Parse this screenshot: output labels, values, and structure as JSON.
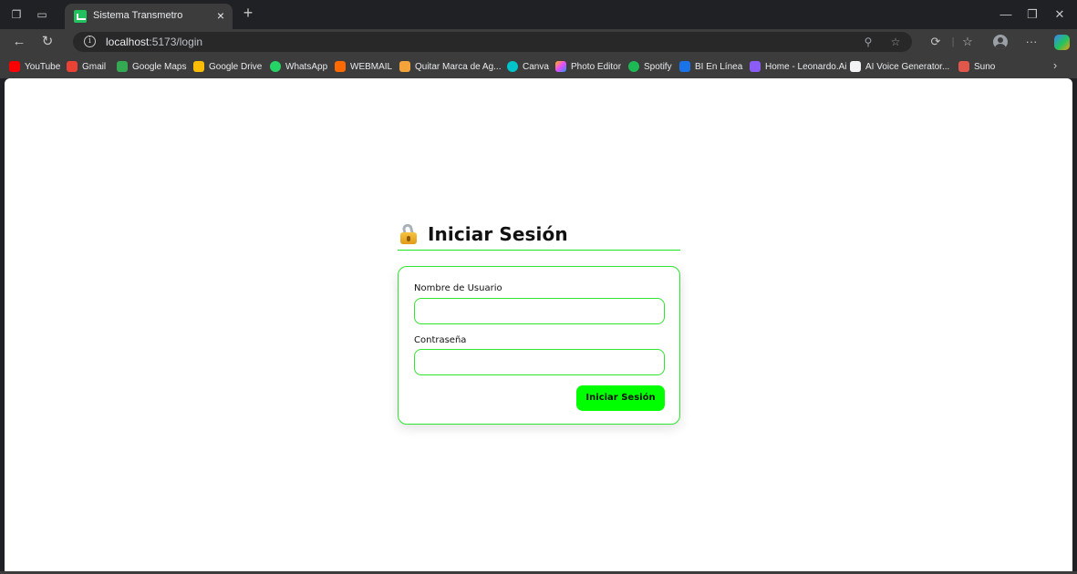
{
  "browser": {
    "tab": {
      "title": "Sistema Transmetro",
      "close_glyph": "×"
    },
    "new_tab_glyph": "+",
    "url": {
      "host": "localhost",
      "rest": ":5173/login"
    },
    "bookmarks": [
      {
        "name": "youtube",
        "label": "YouTube",
        "color": "#ff0000"
      },
      {
        "name": "gmail",
        "label": "Gmail",
        "color": "#ea4335"
      },
      {
        "name": "google-maps",
        "label": "Google Maps",
        "color": "#34a853"
      },
      {
        "name": "google-drive",
        "label": "Google Drive",
        "color": "#fbbc04"
      },
      {
        "name": "whatsapp",
        "label": "WhatsApp",
        "color": "#25d366"
      },
      {
        "name": "webmail",
        "label": "WEBMAIL",
        "color": "#ff6a00"
      },
      {
        "name": "quitar-marca",
        "label": "Quitar Marca de Ag...",
        "color": "#f2a33a"
      },
      {
        "name": "canva",
        "label": "Canva",
        "color": "#00c4cc"
      },
      {
        "name": "photo-editor",
        "label": "Photo Editor",
        "color": "#e94bff"
      },
      {
        "name": "spotify",
        "label": "Spotify",
        "color": "#1db954"
      },
      {
        "name": "bi-en-linea",
        "label": "BI En Línea",
        "color": "#1a73e8"
      },
      {
        "name": "leonardo",
        "label": "Home - Leonardo.Ai",
        "color": "#8b5cf6"
      },
      {
        "name": "ai-voice",
        "label": "AI Voice Generator...",
        "color": "#f1f3f4"
      },
      {
        "name": "suno",
        "label": "Suno",
        "color": "#e2574c"
      }
    ]
  },
  "login": {
    "title": "Iniciar Sesión",
    "username_label": "Nombre de Usuario",
    "username_value": "",
    "password_label": "Contraseña",
    "password_value": "",
    "submit_label": "Iniciar Sesión"
  },
  "colors": {
    "accent": "#00ff00",
    "border": "#2ee62e"
  }
}
